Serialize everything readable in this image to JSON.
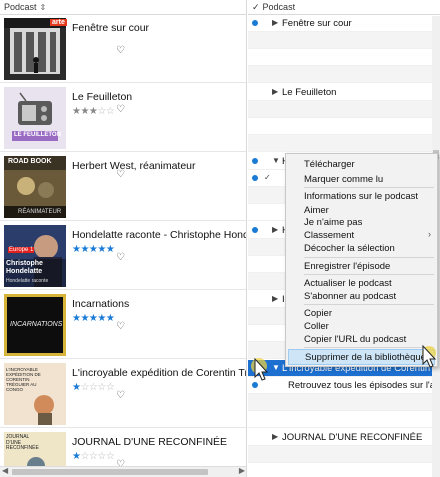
{
  "left": {
    "header": {
      "label": "Podcast",
      "sort_glyph": "⇕"
    },
    "podcasts": [
      {
        "title": "Fenêtre sur cour",
        "rating": 0,
        "rating_style": "none"
      },
      {
        "title": "Le Feuilleton",
        "rating": 3,
        "rating_style": "gray"
      },
      {
        "title": "Herbert West, réanimateur",
        "rating": 0,
        "rating_style": "none"
      },
      {
        "title": "Hondelatte raconte - Christophe Hondelatte",
        "rating": 5,
        "rating_style": "blue"
      },
      {
        "title": "Incarnations",
        "rating": 5,
        "rating_style": "blue"
      },
      {
        "title": "L'incroyable expédition de Corentin Tréguier",
        "rating": 1,
        "rating_style": "blue"
      },
      {
        "title": "JOURNAL D'UNE RECONFINÉE",
        "rating": 1,
        "rating_style": "blue"
      }
    ],
    "covers": {
      "arte": "arte",
      "feuilleton": "LE FEUILLETON",
      "road": "ROAD BOOK",
      "reanimateur": "RÉANIMATEUR",
      "europe1": "Europe 1",
      "hondelatte": "Christophe Hondelatte",
      "hondelatte_sub": "Hondelatte raconte",
      "incarnations": "INCARNATIONS",
      "expedition": "L'INCROYABLE EXPÉDITION DE CORENTIN TRÉGUIER AU CONGO",
      "journal": "JOURNAL D'UNE RECONFINÉE"
    }
  },
  "right": {
    "header": {
      "check": "✓",
      "label": "Podcast"
    },
    "rows": [
      {
        "text": "Fenêtre sur cour",
        "dot": true,
        "tri": "▶"
      },
      {
        "text": "Le Feuilleton",
        "dot": false,
        "tri": "▶"
      },
      {
        "text": "H",
        "dot": true,
        "tri": "▼"
      },
      {
        "text": "",
        "dot": true,
        "tri": "✓"
      },
      {
        "text": "H",
        "dot": true,
        "tri": "▶"
      },
      {
        "text": "In",
        "dot": false,
        "tri": "▶"
      },
      {
        "text": "L'incroyable expédition de Corentin Tréguier",
        "dot": false,
        "tri": "▼"
      },
      {
        "text": "Retrouvez tous les épisodes sur l'appli Radi",
        "dot": true,
        "tri": ""
      },
      {
        "text": "JOURNAL D'UNE RECONFINÉE",
        "dot": false,
        "tri": "▶"
      }
    ]
  },
  "context_menu": {
    "items": [
      "Télécharger",
      "Marquer comme lu",
      "Informations sur le podcast",
      "Aimer",
      "Je n'aime pas",
      "Classement",
      "Décocher la sélection",
      "Enregistrer l'épisode",
      "Actualiser le podcast",
      "S'abonner au podcast",
      "Copier",
      "Coller",
      "Copier l'URL du podcast",
      "Supprimer de la bibliothèque"
    ],
    "submenu_arrow": "›",
    "highlighted": "Supprimer de la bibliothèque"
  },
  "colors": {
    "accent": "#1a7bd6",
    "selection": "#1d6fd0",
    "menu_highlight": "#cde5f7"
  }
}
